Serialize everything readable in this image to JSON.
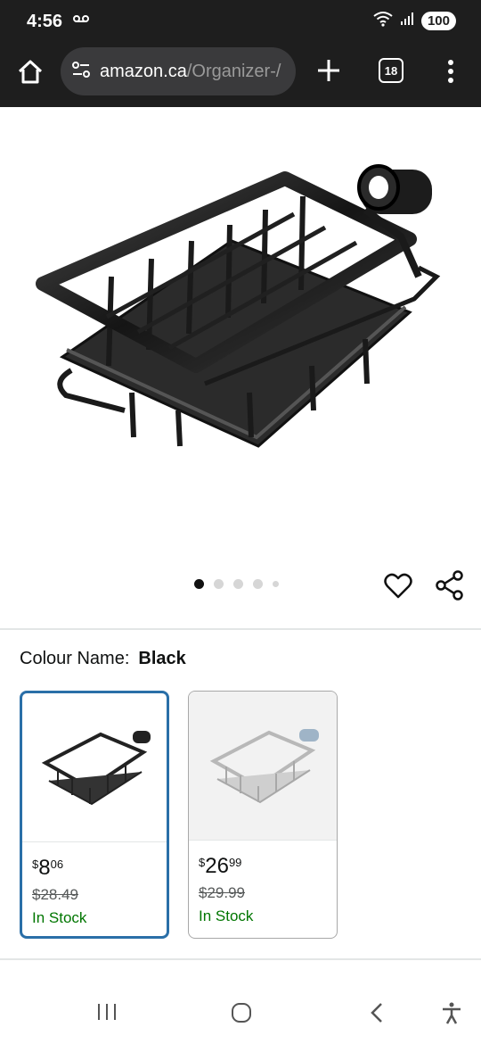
{
  "status_bar": {
    "time": "4:56",
    "battery": "100"
  },
  "browser": {
    "url_domain": "amazon.ca",
    "url_path": "/Organizer-/",
    "tab_count": "18"
  },
  "carousel": {
    "total_images": 5,
    "active_index": 0
  },
  "colour": {
    "label": "Colour Name:",
    "selected": "Black"
  },
  "swatches": [
    {
      "price_symbol": "$",
      "price_whole": "8",
      "price_fraction": "06",
      "list_price": "$28.49",
      "stock": "In Stock",
      "color": "black",
      "selected": true
    },
    {
      "price_symbol": "$",
      "price_whole": "26",
      "price_fraction": "99",
      "list_price": "$29.99",
      "stock": "In Stock",
      "color": "silver",
      "selected": false
    }
  ],
  "colors": {
    "accent": "#2a6fa8",
    "in_stock": "#007600",
    "chrome_dark": "#1e1e1e"
  }
}
